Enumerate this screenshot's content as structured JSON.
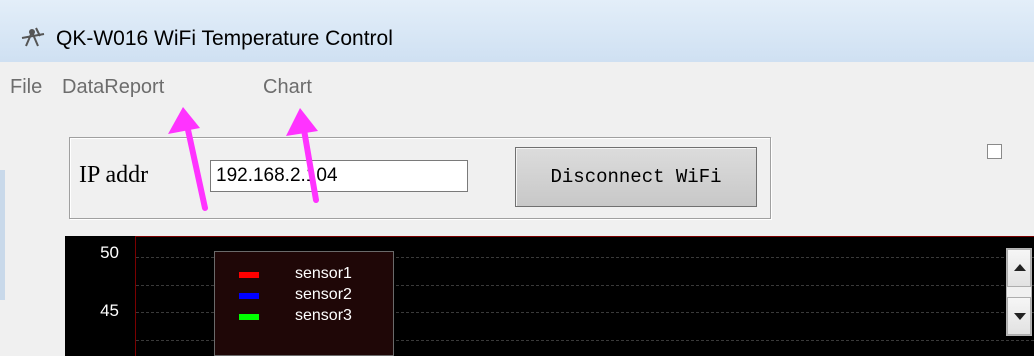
{
  "window": {
    "title": "QK-W016   WiFi Temperature Control",
    "icon": "thermometer-link-icon"
  },
  "menu": {
    "items": [
      {
        "label": "File"
      },
      {
        "label": "DataReport"
      },
      {
        "label": "Chart"
      }
    ]
  },
  "connection": {
    "ip_label": "IP addr",
    "ip_value": "192.168.2.104",
    "button_label": "Disconnect WiFi",
    "checkbox_checked": false
  },
  "chart_data": {
    "type": "line",
    "background": "#000000",
    "y_ticks": [
      "50",
      "45"
    ],
    "legend": [
      {
        "name": "sensor1",
        "color": "#ff0000"
      },
      {
        "name": "sensor2",
        "color": "#0000ff"
      },
      {
        "name": "sensor3",
        "color": "#00ff00"
      }
    ],
    "series": []
  },
  "annotations": {
    "arrow_color": "#ff33ff",
    "targets": [
      "DataReport",
      "Chart"
    ]
  }
}
